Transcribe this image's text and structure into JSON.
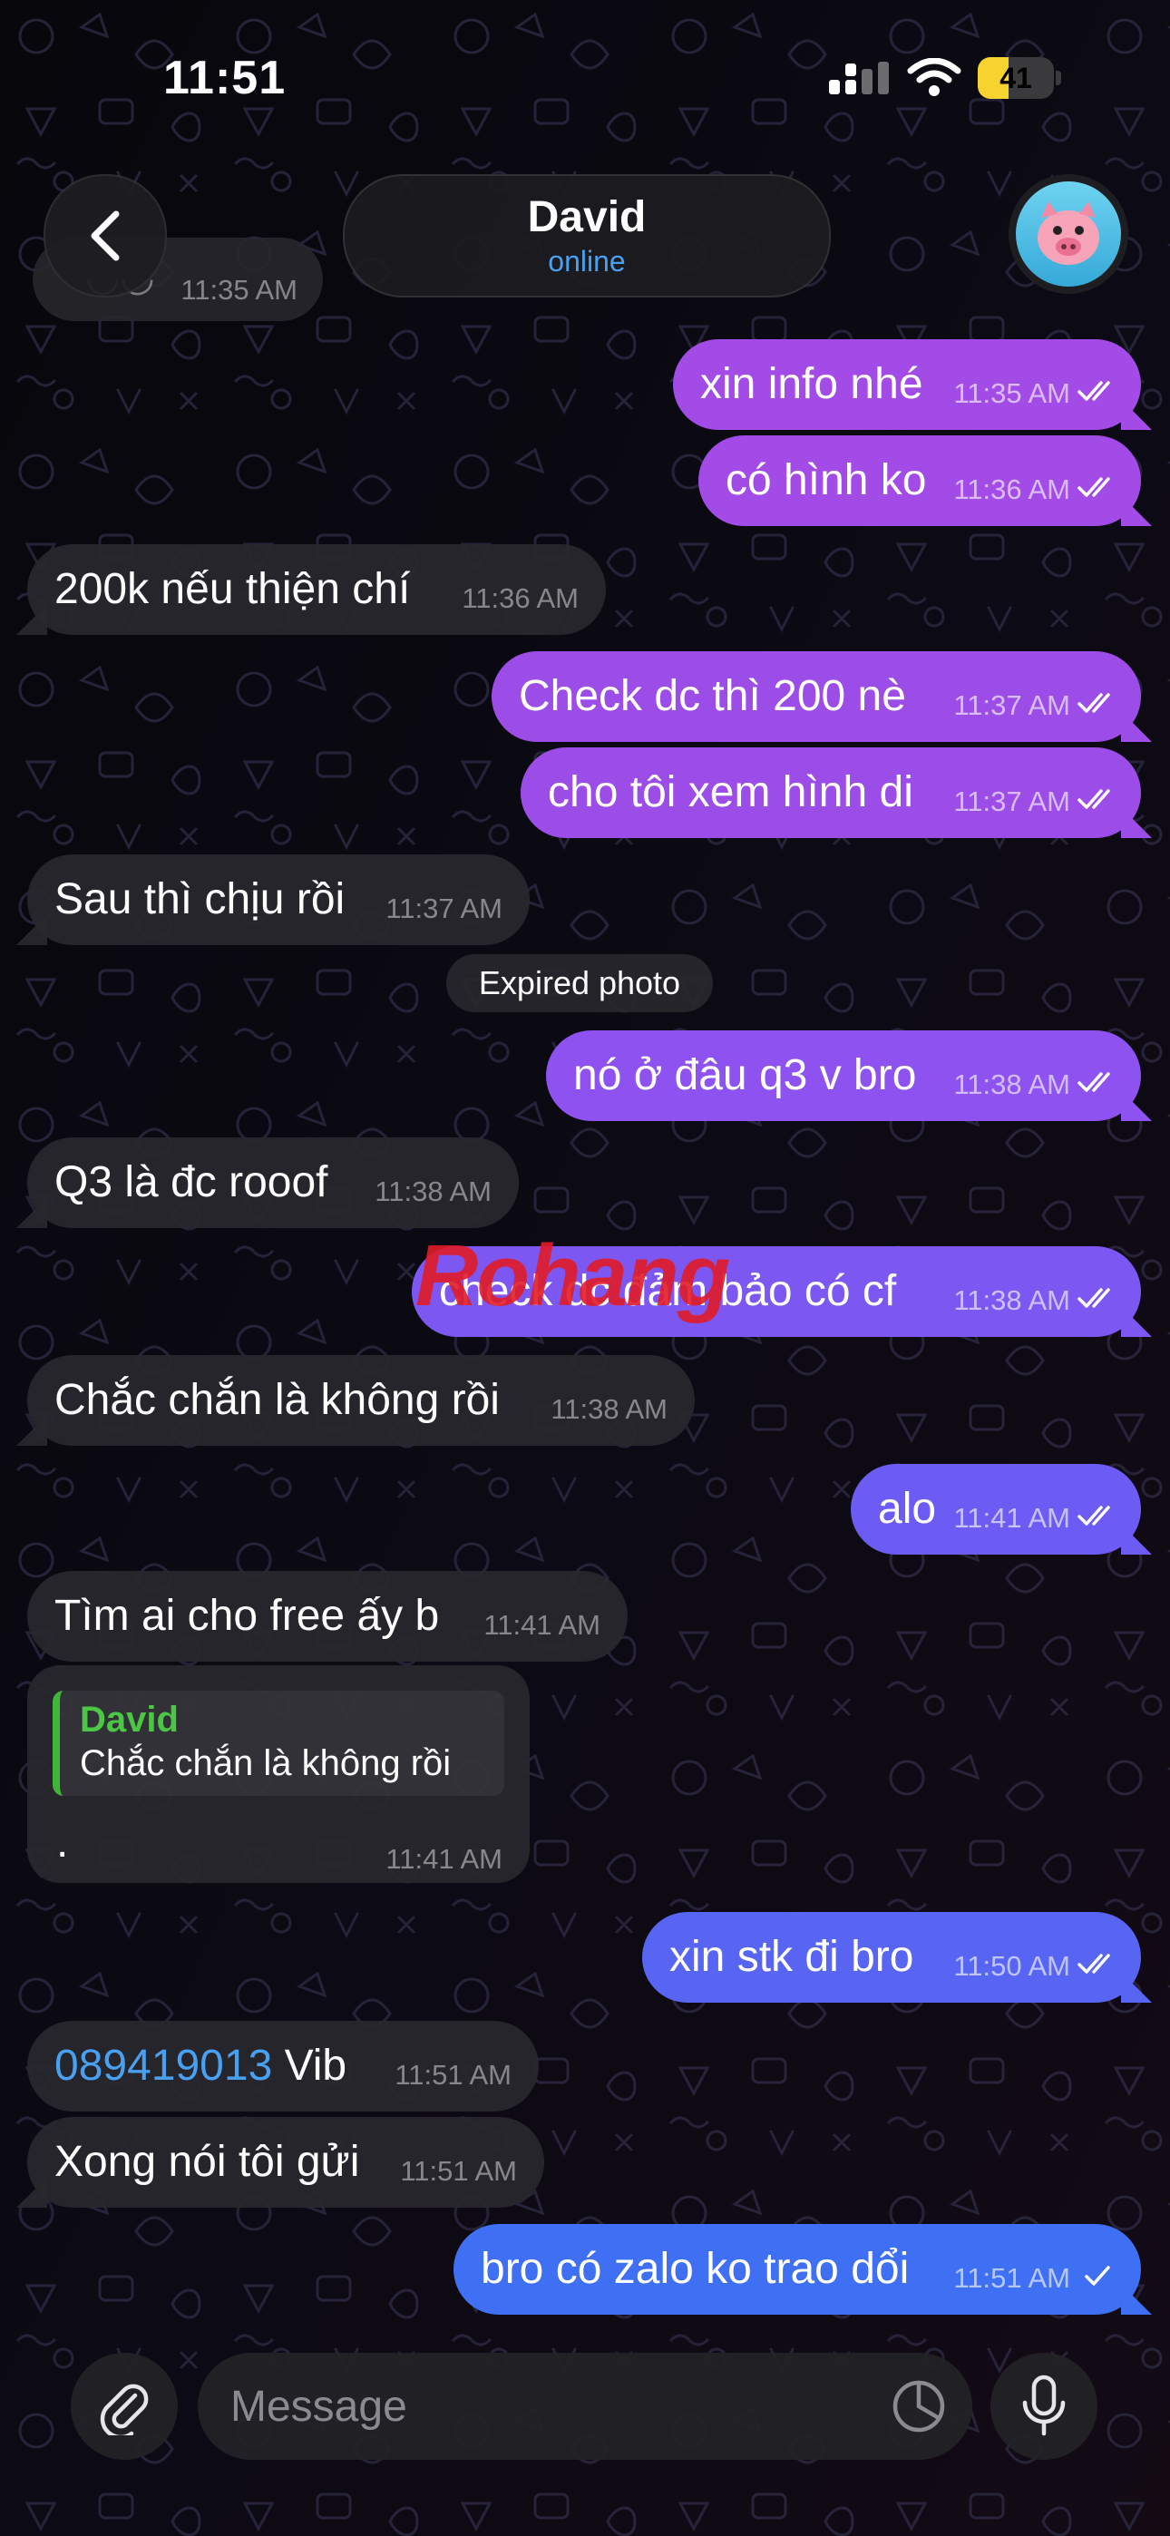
{
  "status_bar": {
    "time": "11:51",
    "battery": "41",
    "battery_level": 0.41
  },
  "header": {
    "name": "David",
    "status": "online"
  },
  "partial_message": {
    "time": "11:35 AM"
  },
  "messages": [
    {
      "dir": "out",
      "text": "xin info nhé",
      "time": "11:35 AM",
      "read": true
    },
    {
      "dir": "out",
      "text": "có hình ko",
      "time": "11:36 AM",
      "read": true
    },
    {
      "dir": "in",
      "text": "200k nếu thiện chí",
      "time": "11:36 AM"
    },
    {
      "dir": "out",
      "text": "Check dc thì 200 nè",
      "time": "11:37 AM",
      "read": true
    },
    {
      "dir": "out",
      "text": "cho tôi xem hình di",
      "time": "11:37 AM",
      "read": true
    },
    {
      "dir": "in",
      "text": "Sau thì chịu rồi",
      "time": "11:37 AM"
    },
    {
      "dir": "service",
      "text": "Expired photo"
    },
    {
      "dir": "out",
      "text": "nó ở đâu q3 v bro",
      "time": "11:38 AM",
      "read": true
    },
    {
      "dir": "in",
      "text": "Q3 là đc rooof",
      "time": "11:38 AM"
    },
    {
      "dir": "out",
      "text": "check dc đảm bảo có cf",
      "time": "11:38 AM",
      "read": true
    },
    {
      "dir": "in",
      "text": "Chắc chắn là không rồi",
      "time": "11:38 AM"
    },
    {
      "dir": "out",
      "text": "alo",
      "time": "11:41 AM",
      "read": true
    },
    {
      "dir": "in",
      "text": "Tìm ai cho free ấy b",
      "time": "11:41 AM"
    },
    {
      "dir": "in",
      "reply_to": {
        "name": "David",
        "text": "Chắc chắn là không rồi"
      },
      "text": ".",
      "time": "11:41 AM"
    },
    {
      "dir": "out",
      "text": "xin stk đi bro",
      "time": "11:50 AM",
      "read": true
    },
    {
      "dir": "in",
      "phone": "089419013",
      "text": " Vib",
      "time": "11:51 AM"
    },
    {
      "dir": "in",
      "text": "Xong nói tôi gửi",
      "time": "11:51 AM"
    },
    {
      "dir": "out",
      "text": "bro có zalo ko trao dổi",
      "time": "11:51 AM",
      "read": false
    }
  ],
  "watermark": {
    "text": "Rohang"
  },
  "input": {
    "placeholder": "Message"
  },
  "colors": {
    "bubble_in": "#28282e",
    "bubble_out_gradient": [
      "#a24be6",
      "#8d52f0",
      "#6b5cf4",
      "#3f6ff2"
    ],
    "link": "#4aa0f0",
    "reply_accent": "#3fb53a",
    "battery": "#f6d32e"
  },
  "icons": [
    "back-chevron-icon",
    "signal-icon",
    "wifi-icon",
    "battery-icon",
    "pig-avatar-icon",
    "double-check-icon",
    "single-check-icon",
    "paperclip-icon",
    "sticker-icon",
    "microphone-icon"
  ]
}
